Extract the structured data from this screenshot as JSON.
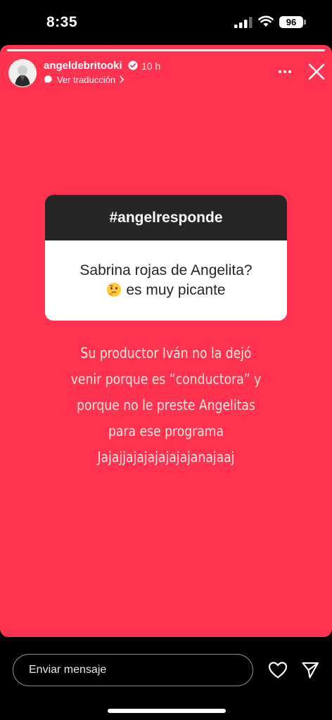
{
  "status_bar": {
    "time": "8:35",
    "battery": "96"
  },
  "story": {
    "background_color": "#ff3250",
    "username": "angeldebritooki",
    "time_ago": "10 h",
    "translate_label": "Ver traducción",
    "question_sticker": {
      "header": "#angelresponde",
      "line1": "Sabrina rojas de Angelita?",
      "line2_emoji": "thinking-face-icon",
      "line2": "es muy picante"
    },
    "answer_lines": [
      "Su productor Iván no la dejó",
      "venir porque es “conductora” y",
      "porque no le preste  Angelitas",
      "para ese programa",
      "Jajajjajajajajajajanajaaj"
    ]
  },
  "footer": {
    "message_placeholder": "Enviar mensaje"
  }
}
